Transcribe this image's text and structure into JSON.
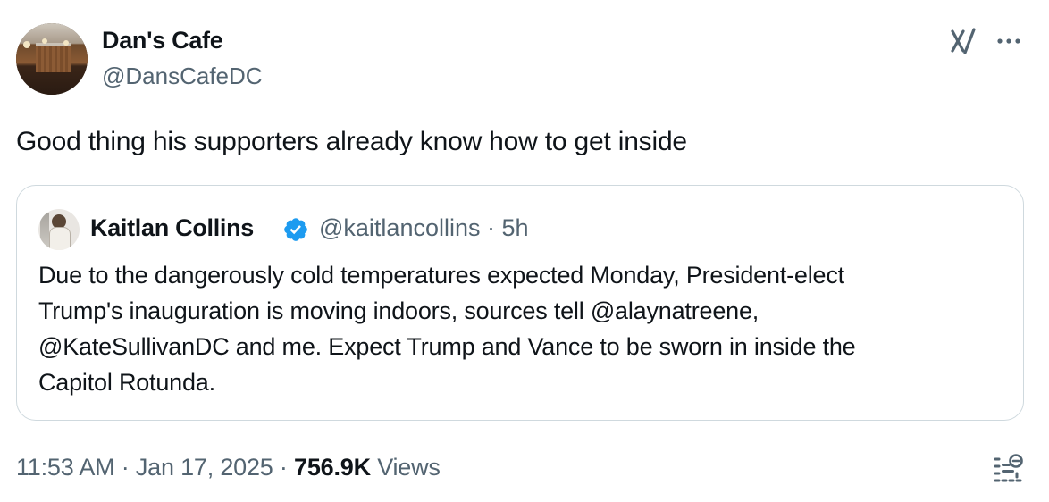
{
  "tweet": {
    "author_name": "Dan's Cafe",
    "author_handle": "@DansCafeDC",
    "text": "Good thing his supporters already know how to get inside",
    "timestamp": "11:53 AM · Jan 17, 2025",
    "separator": " · ",
    "views_count": "756.9K",
    "views_label": " Views"
  },
  "quoted_tweet": {
    "author_name": "Kaitlan Collins",
    "handle_and_time": "@kaitlancollins · 5h",
    "verified": true,
    "text_lines": [
      "Due to the dangerously cold temperatures expected Monday, President-elect",
      "Trump's inauguration is moving indoors, sources tell @alaynatreene,",
      "@KateSullivanDC and me. Expect Trump and Vance to be sworn in inside the",
      "Capitol Rotunda."
    ]
  },
  "icons": {
    "grok": "grok-icon",
    "more": "more-icon",
    "verified": "verified-badge-icon",
    "analytics": "analytics-icon"
  },
  "colors": {
    "text_primary": "#0f1419",
    "text_secondary": "#536471",
    "border": "#cfd9de",
    "verified_blue": "#1d9bf0"
  }
}
